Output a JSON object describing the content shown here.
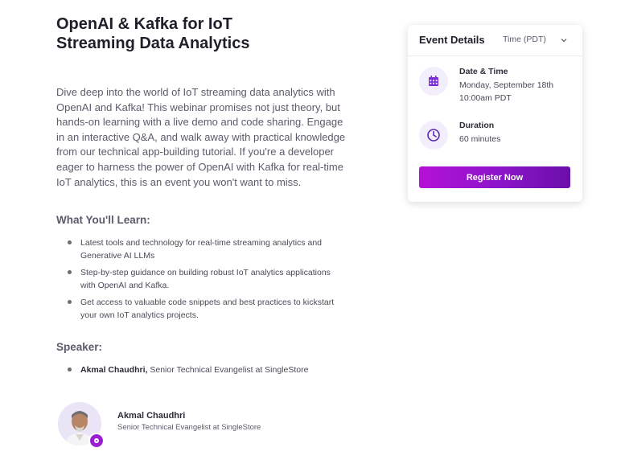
{
  "event": {
    "title_line1": "OpenAI & Kafka for IoT",
    "title_line2": "Streaming Data Analytics",
    "description": "Dive deep into the world of IoT streaming data analytics with OpenAI and Kafka! This webinar promises not just theory, but hands-on learning with a live demo and code sharing. Engage in an interactive Q&A, and walk away with practical knowledge from our technical app-building tutorial. If you're a developer eager to harness the power of OpenAI with Kafka for real-time IoT analytics, this is an event you won't want to miss."
  },
  "learn": {
    "heading": "What You'll Learn:",
    "items": [
      "Latest tools and technology for real-time streaming analytics and Generative AI LLMs",
      "Step-by-step guidance on building robust IoT analytics applications with OpenAI and Kafka.",
      "Get access to valuable code snippets and best practices to kickstart your own IoT analytics projects."
    ]
  },
  "speaker_section": {
    "heading": "Speaker:",
    "name": "Akmal Chaudhri,",
    "role": "Senior Technical Evangelist at SingleStore"
  },
  "speaker_card": {
    "name": "Akmal Chaudhri",
    "role": "Senior Technical Evangelist at SingleStore"
  },
  "details": {
    "title": "Event Details",
    "timezone": "Time (PDT)",
    "date_label": "Date & Time",
    "date_value_line1": "Monday, September 18th",
    "date_value_line2": "10:00am PDT",
    "duration_label": "Duration",
    "duration_value": "60 minutes",
    "register_label": "Register Now"
  },
  "colors": {
    "accent": "#8a14c9",
    "icon_bg": "#f3eefc"
  },
  "icons": {
    "date": "calendar-icon",
    "duration": "clock-icon",
    "timezone": "chevron-down-icon",
    "badge": "singlestore-badge-icon"
  }
}
